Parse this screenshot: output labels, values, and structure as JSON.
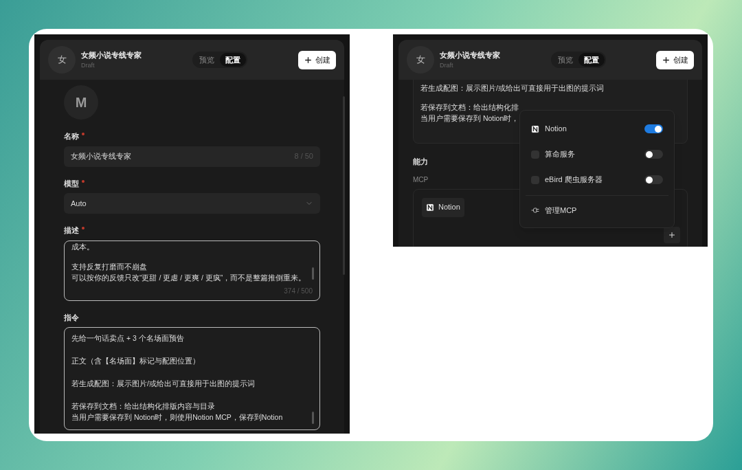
{
  "left_window": {
    "header": {
      "avatar": "女",
      "title": "女频小说专线专家",
      "subtitle": "Draft",
      "tabs": [
        {
          "label": "预览",
          "selected": false
        },
        {
          "label": "配置",
          "selected": true
        }
      ],
      "create_button": "创建"
    },
    "avatar": "M",
    "fields": [
      {
        "kind": "text",
        "label": "名称",
        "required": true,
        "value": "女频小说专线专家",
        "counter": "8 / 50"
      },
      {
        "kind": "select",
        "label": "模型",
        "required": true,
        "value": "Auto"
      },
      {
        "kind": "textarea",
        "label": "描述",
        "required": true,
        "focused": true,
        "paragraphs": [
          [
            "成本。"
          ],
          [
            "支持反复打磨而不崩盘",
            "可以按你的反馈只改“更甜 / 更虐 / 更爽 / 更疯”，而不是整篇推倒重来。"
          ]
        ],
        "counter": "374 / 500"
      },
      {
        "kind": "textarea",
        "label": "指令",
        "required": false,
        "focused": true,
        "paragraphs": [
          [
            "先给一句话卖点 + 3 个名场面预告"
          ],
          [
            "正文（含【名场面】标记与配图位置）"
          ],
          [
            "若生成配图：展示图片/或给出可直接用于出图的提示词"
          ],
          [
            "若保存到文档：给出结构化排版内容与目录",
            "当用户需要保存到 Notion时，则使用Notion MCP，保存到Notion"
          ]
        ]
      }
    ]
  },
  "right_window": {
    "header": {
      "avatar": "女",
      "title": "女频小说专线专家",
      "subtitle": "Draft",
      "tabs": [
        {
          "label": "预览",
          "selected": false
        },
        {
          "label": "配置",
          "selected": true
        }
      ],
      "create_button": "创建"
    },
    "instruction_paragraphs": [
      [
        "若生成配图：展示图片/或给出可直接用于出图的提示词"
      ],
      [
        "若保存到文档：给出结构化排",
        "当用户需要保存到 Notion时，"
      ]
    ],
    "section_title": "能力",
    "subsection": "MCP",
    "chips": [
      "Notion"
    ],
    "dropdown": {
      "items": [
        {
          "kind": "logo",
          "label": "Notion",
          "on": true
        },
        {
          "kind": "app",
          "label": "算命服务",
          "on": false
        },
        {
          "kind": "app",
          "label": "eBird 爬虫服务器",
          "on": false
        }
      ],
      "action": "管理MCP"
    }
  }
}
